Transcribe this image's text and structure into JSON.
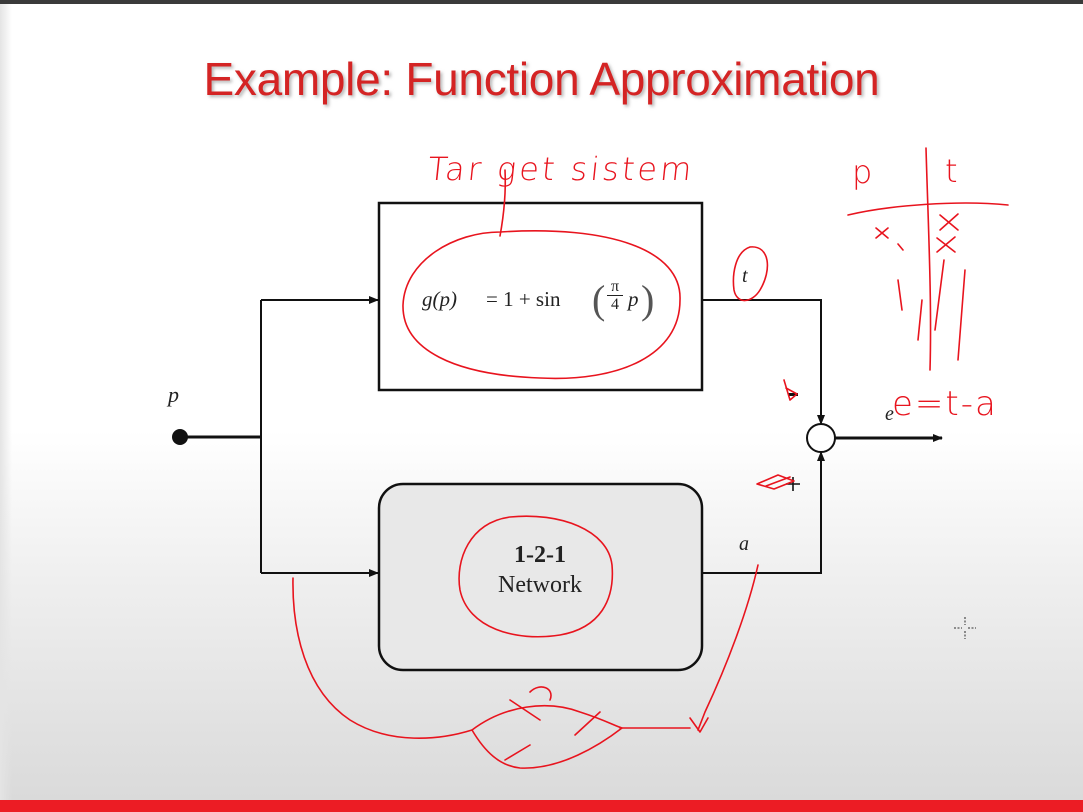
{
  "slide": {
    "title": "Example: Function Approximation",
    "colors": {
      "title": "#d42424",
      "annotation": "#e8141e",
      "bottom_bar": "#ec1c24"
    }
  },
  "diagram": {
    "input_label": "p",
    "target_label": "t",
    "network_output_label": "a",
    "error_label": "e",
    "target_system": {
      "equation_lhs": "g(p)",
      "equation_rhs_prefix": "= 1 + sin",
      "fraction_numerator": "π",
      "fraction_denominator": "4",
      "argument_variable": "p"
    },
    "network": {
      "line1": "1-2-1",
      "line2": "Network"
    },
    "summing_junction_signs": [
      "-",
      "+"
    ]
  },
  "annotations": {
    "target_system_note": "Tar get sistem",
    "table_headers": [
      "p",
      "t"
    ],
    "error_formula": "e=t-a"
  },
  "icons": {
    "cursor": "crosshair-cursor-icon"
  }
}
